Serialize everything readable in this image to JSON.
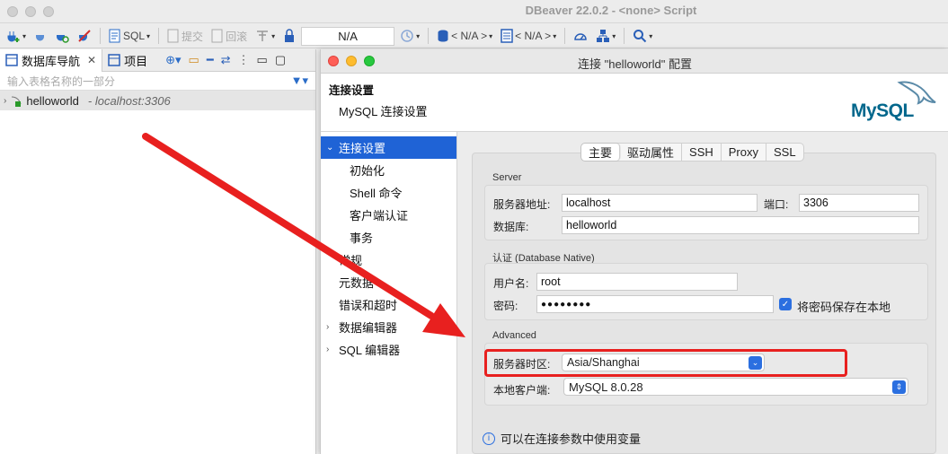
{
  "app": {
    "title": "DBeaver 22.0.2 - <none> Script"
  },
  "toolbar": {
    "sql_label": "SQL",
    "commit_label": "提交",
    "rollback_label": "回滚",
    "na_box": "N/A",
    "schema_label": "< N/A >",
    "catalog_label": "< N/A >"
  },
  "left_panel": {
    "tab_navigator": "数据库导航",
    "tab_projects": "项目",
    "filter_placeholder": "输入表格名称的一部分",
    "connection": {
      "name": "helloworld",
      "host": "- localhost:3306"
    }
  },
  "dialog": {
    "title": "连接 \"helloworld\" 配置",
    "header_title": "连接设置",
    "header_subtitle": "MySQL 连接设置",
    "logo_text": "MySQL",
    "sidebar": [
      {
        "label": "连接设置",
        "selected": true,
        "arrow": "v"
      },
      {
        "label": "初始化",
        "sub": true
      },
      {
        "label": "Shell 命令",
        "sub": true
      },
      {
        "label": "客户端认证",
        "sub": true
      },
      {
        "label": "事务",
        "sub": true
      },
      {
        "label": "常规"
      },
      {
        "label": "元数据"
      },
      {
        "label": "错误和超时"
      },
      {
        "label": "数据编辑器",
        "arrow": ">"
      },
      {
        "label": "SQL 编辑器",
        "arrow": ">"
      }
    ],
    "tabs": [
      "主要",
      "驱动属性",
      "SSH",
      "Proxy",
      "SSL"
    ],
    "server": {
      "legend": "Server",
      "host_label": "服务器地址:",
      "host_value": "localhost",
      "port_label": "端口:",
      "port_value": "3306",
      "db_label": "数据库:",
      "db_value": "helloworld"
    },
    "auth": {
      "legend": "认证 (Database Native)",
      "user_label": "用户名:",
      "user_value": "root",
      "password_label": "密码:",
      "password_value": "●●●●●●●●",
      "save_password_label": "将密码保存在本地"
    },
    "advanced": {
      "legend": "Advanced",
      "timezone_label": "服务器时区:",
      "timezone_value": "Asia/Shanghai",
      "client_label": "本地客户端:",
      "client_value": "MySQL 8.0.28"
    },
    "info_text": "可以在连接参数中使用变量"
  },
  "colors": {
    "accent": "#1f63d6",
    "annotation": "#e8201f"
  }
}
